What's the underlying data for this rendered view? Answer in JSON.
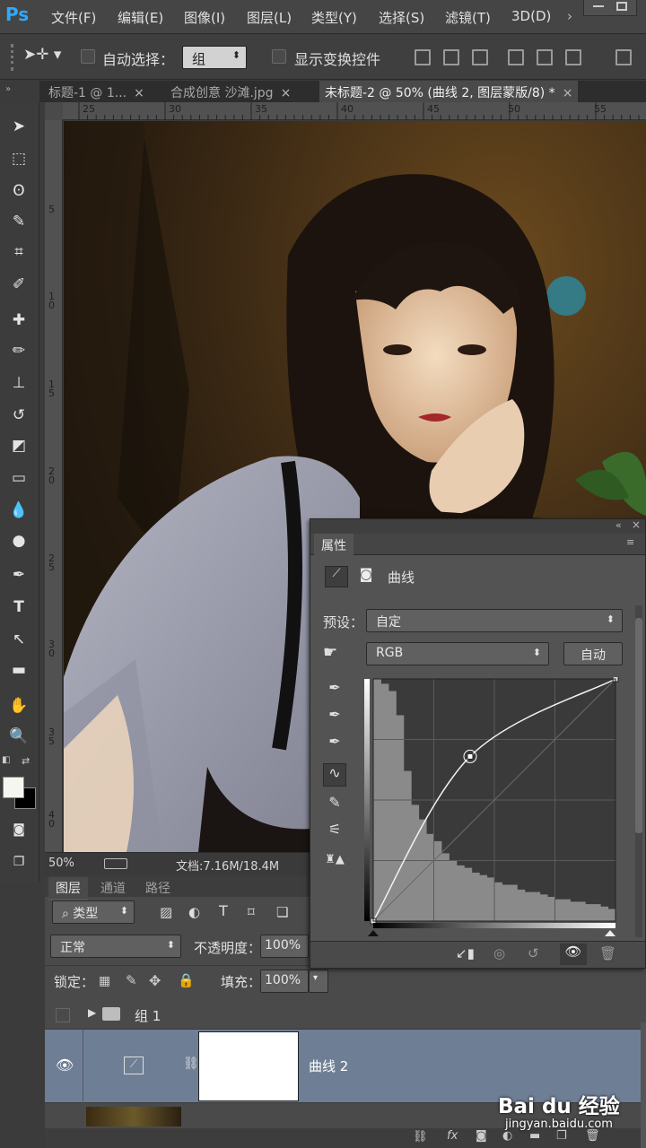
{
  "app": {
    "logo": "Ps"
  },
  "menu": [
    "文件(F)",
    "编辑(E)",
    "图像(I)",
    "图层(L)",
    "类型(Y)",
    "选择(S)",
    "滤镜(T)",
    "3D(D)"
  ],
  "options": {
    "auto_select_label": "自动选择：",
    "auto_select_value": "组",
    "show_transform_label": "显示变换控件"
  },
  "tabs": [
    {
      "label": "标题-1 @ 1...",
      "active": false
    },
    {
      "label": "合成创意 沙滩.jpg",
      "active": false
    },
    {
      "label": "未标题-2 @ 50% (曲线 2, 图层蒙版/8) *",
      "active": true
    }
  ],
  "ruler": {
    "top_ticks": [
      "25",
      "30",
      "35",
      "40",
      "45",
      "50",
      "55"
    ],
    "left_ticks": [
      "5",
      "1\n0",
      "1\n5",
      "2\n0",
      "2\n5",
      "3\n0",
      "3\n5",
      "4\n0"
    ]
  },
  "status": {
    "zoom": "50%",
    "doc": "文档:7.16M/18.4M"
  },
  "properties": {
    "tab": "属性",
    "title": "曲线",
    "preset_label": "预设：",
    "preset_value": "自定",
    "channel_value": "RGB",
    "auto_button": "自动"
  },
  "curve": {
    "points": [
      [
        0,
        0
      ],
      [
        0.4,
        0.68
      ],
      [
        1,
        1
      ]
    ],
    "histogram": [
      1.0,
      0.98,
      0.95,
      0.85,
      0.62,
      0.48,
      0.42,
      0.36,
      0.33,
      0.28,
      0.25,
      0.23,
      0.22,
      0.2,
      0.19,
      0.18,
      0.16,
      0.15,
      0.15,
      0.13,
      0.12,
      0.12,
      0.11,
      0.1,
      0.09,
      0.09,
      0.08,
      0.08,
      0.07,
      0.07,
      0.06,
      0.05
    ]
  },
  "layers": {
    "tabs": [
      "图层",
      "通道",
      "路径"
    ],
    "filter_label": "类型",
    "blend_mode": "正常",
    "opacity_label": "不透明度：",
    "opacity_value": "100%",
    "lock_label": "锁定：",
    "fill_label": "填充：",
    "fill_value": "100%",
    "items": [
      {
        "name": "组 1",
        "type": "group"
      },
      {
        "name": "曲线 2",
        "type": "curves",
        "selected": true
      }
    ]
  },
  "watermark": {
    "brand": "Bai du 经验",
    "url": "jingyan.baidu.com"
  }
}
